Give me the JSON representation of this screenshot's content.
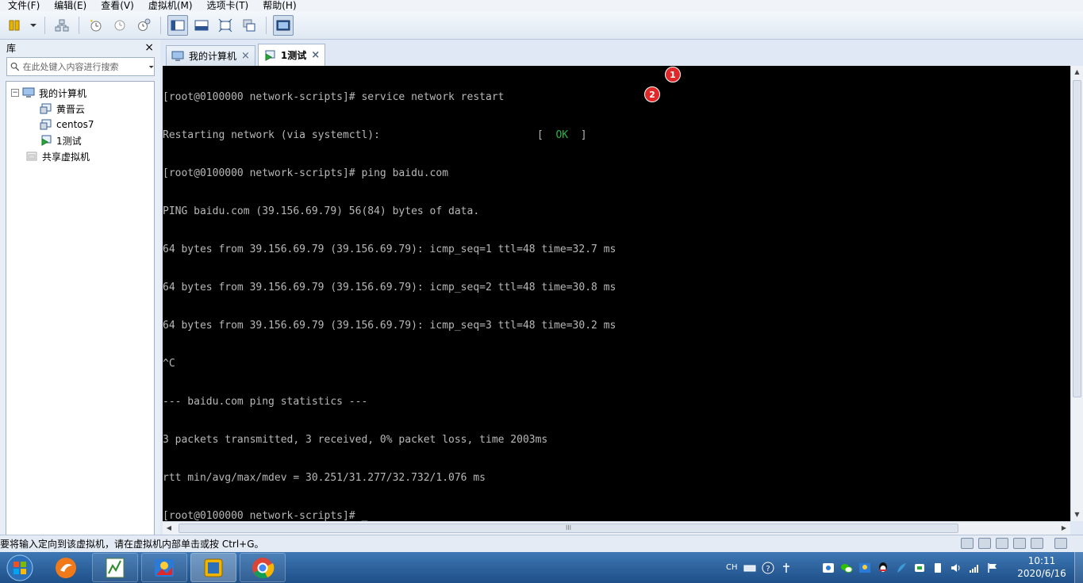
{
  "menu": [
    "文件(F)",
    "编辑(E)",
    "查看(V)",
    "虚拟机(M)",
    "选项卡(T)",
    "帮助(H)"
  ],
  "library": {
    "title": "库",
    "close": "×",
    "search_placeholder": "在此处键入内容进行搜索",
    "tree": [
      {
        "label": "我的计算机",
        "level": 0,
        "toggle": "⊟"
      },
      {
        "label": "黄晋云",
        "level": 1
      },
      {
        "label": "centos7",
        "level": 1
      },
      {
        "label": "1测试",
        "level": 1
      },
      {
        "label": "共享虚拟机",
        "level": 0
      }
    ]
  },
  "tabs": [
    {
      "label": "我的计算机",
      "close": "×"
    },
    {
      "label": "1测试",
      "close": "×"
    }
  ],
  "console": {
    "lines": [
      "[root@0100000 network-scripts]# service network restart",
      "Restarting network (via systemctl):",
      "[root@0100000 network-scripts]# ping baidu.com",
      "PING baidu.com (39.156.69.79) 56(84) bytes of data.",
      "64 bytes from 39.156.69.79 (39.156.69.79): icmp_seq=1 ttl=48 time=32.7 ms",
      "64 bytes from 39.156.69.79 (39.156.69.79): icmp_seq=2 ttl=48 time=30.8 ms",
      "64 bytes from 39.156.69.79 (39.156.69.79): icmp_seq=3 ttl=48 time=30.2 ms",
      "^C",
      "--- baidu.com ping statistics ---",
      "3 packets transmitted, 3 received, 0% packet loss, time 2003ms",
      "rtt min/avg/max/mdev = 30.251/31.277/32.732/1.076 ms",
      "[root@0100000 network-scripts]# _"
    ],
    "ok_open": "[",
    "ok_text": "OK",
    "ok_close": "]",
    "callouts": [
      "1",
      "2"
    ]
  },
  "scrollbar": {
    "grip": "III",
    "left": "◀",
    "right": "▶",
    "up": "▲",
    "down": "▼"
  },
  "status_text": "要将输入定向到该虚拟机，请在虚拟机内部单击或按 Ctrl+G。",
  "tray": {
    "lang": "CH"
  },
  "clock": {
    "time": "10:11",
    "date": "2020/6/16"
  },
  "colors": {
    "console_bg": "#000000",
    "console_text": "#b8b8b8",
    "ok_green": "#27b64b",
    "callout_red": "#e02828"
  }
}
